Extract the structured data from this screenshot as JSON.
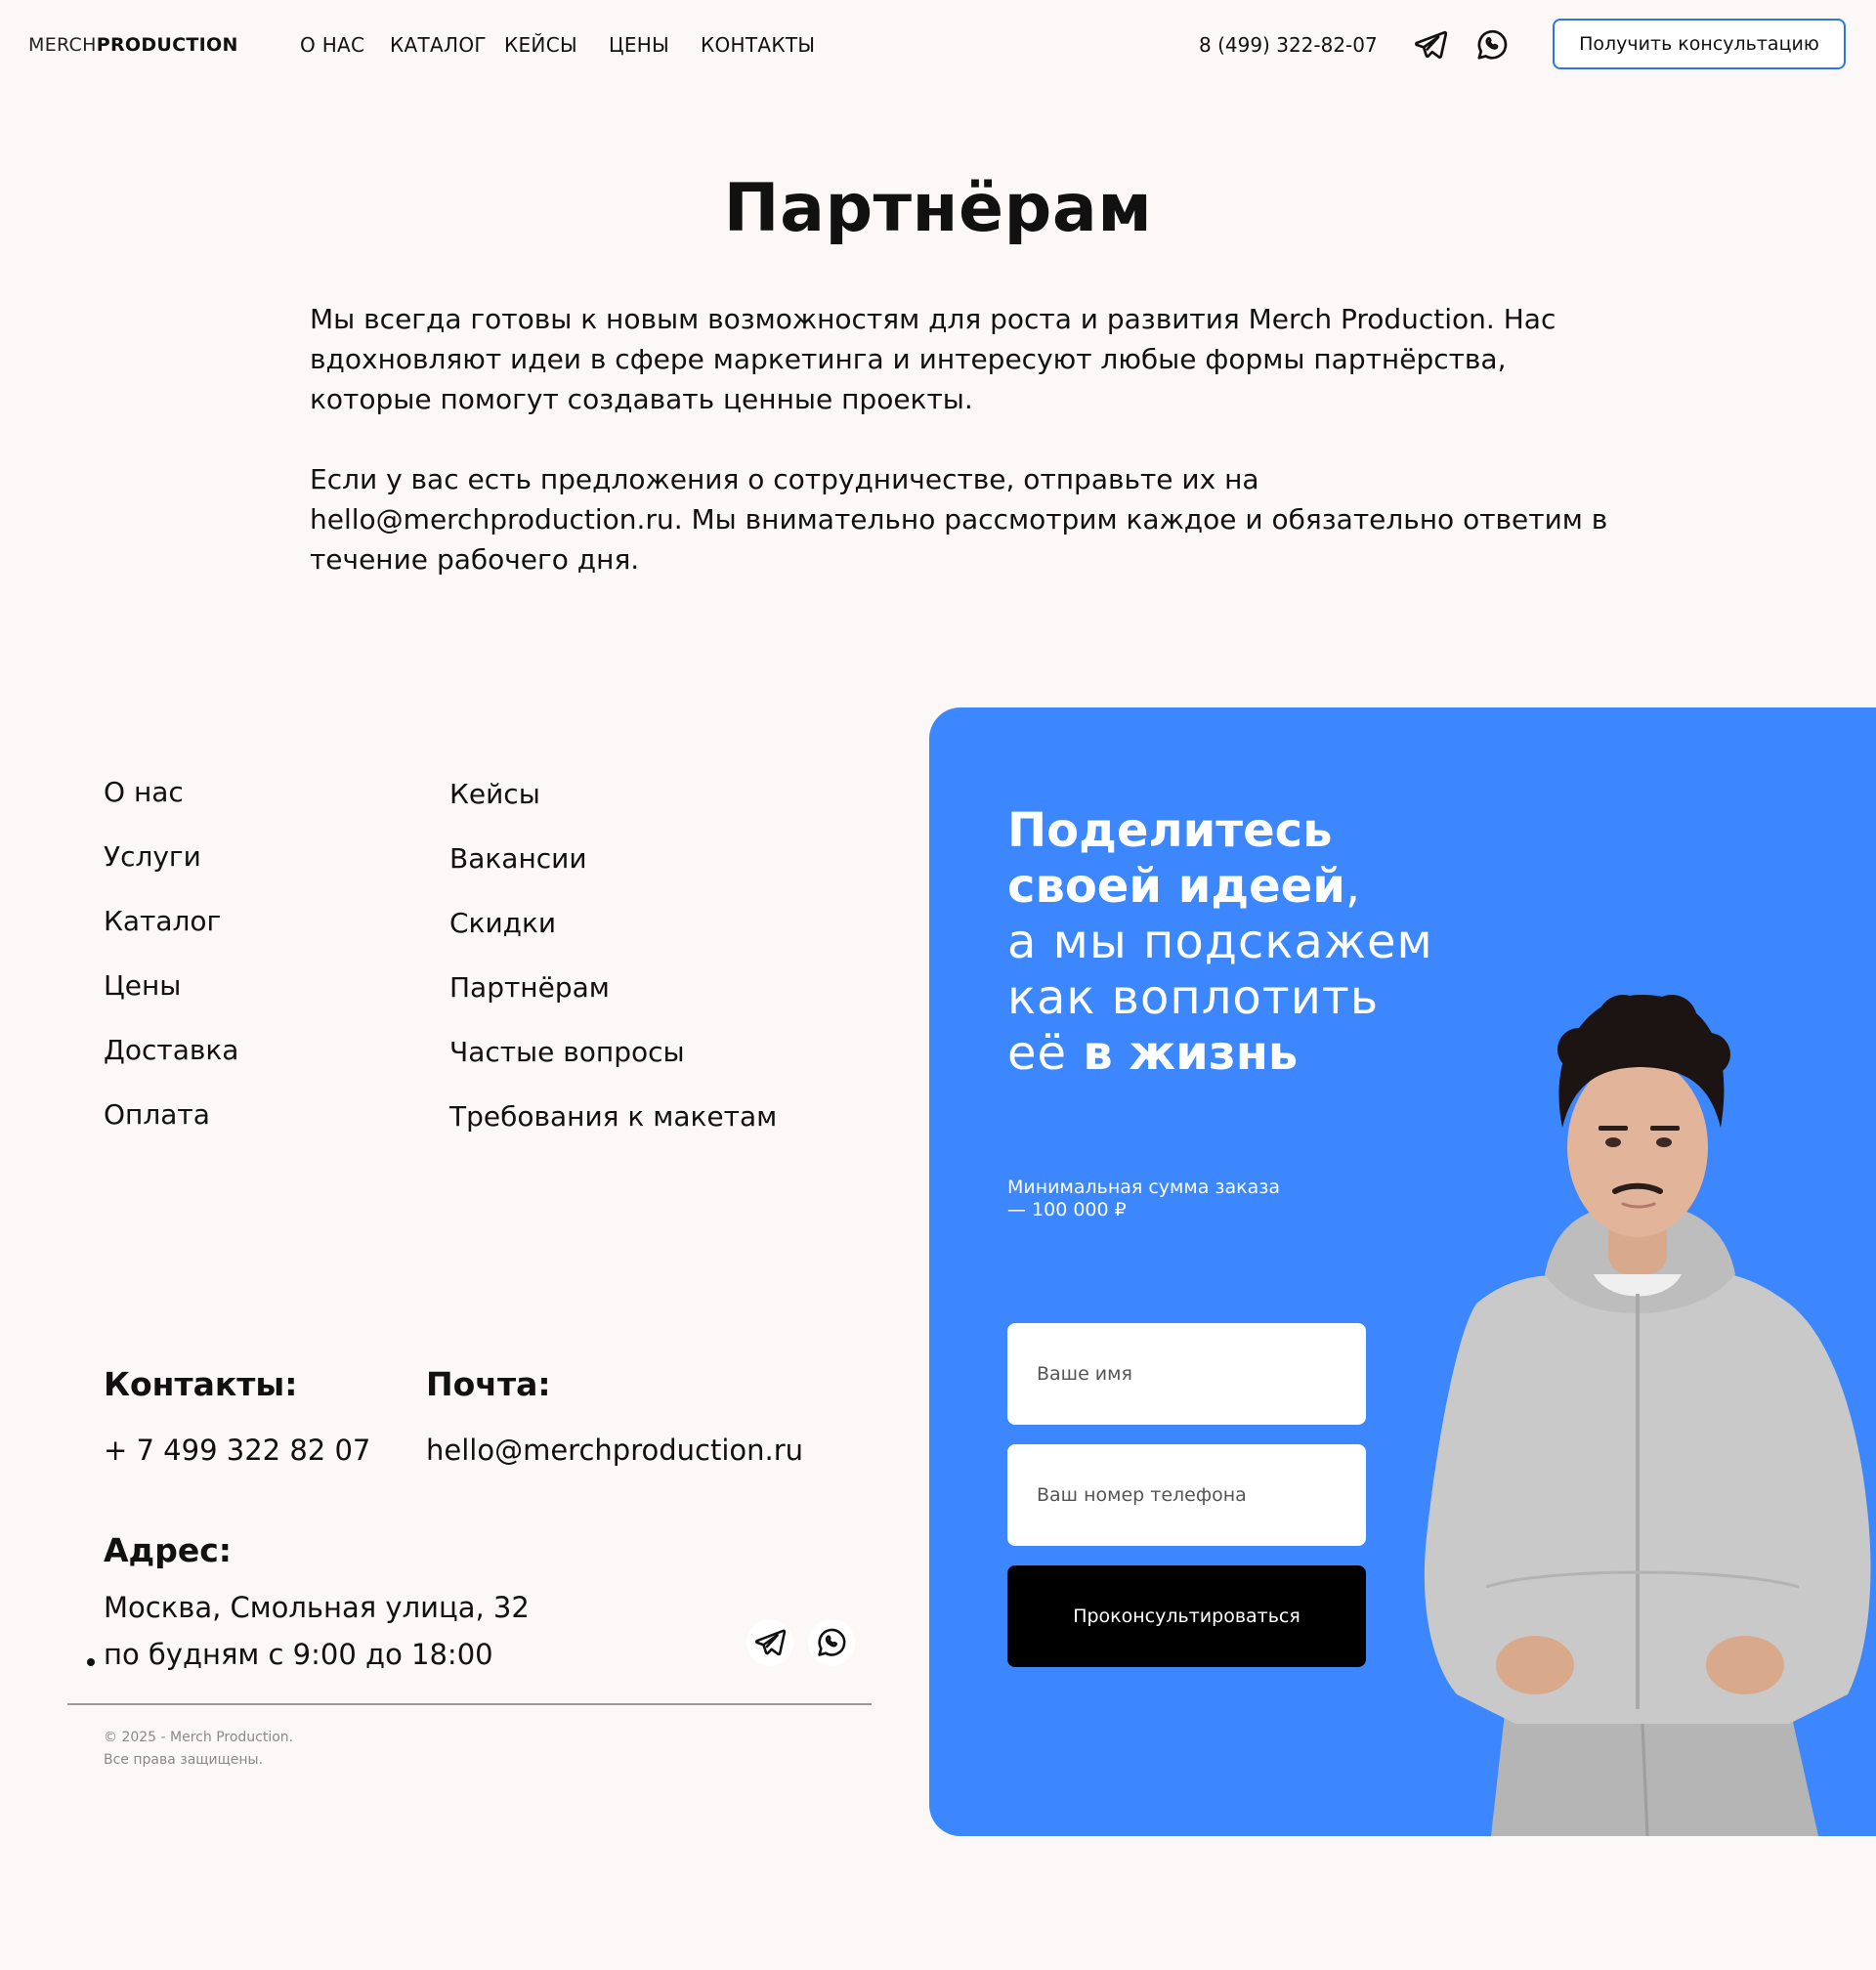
{
  "header": {
    "logo_light": "MERCH",
    "logo_bold": "PRODUCTION",
    "nav": [
      "О НАС",
      "КАТАЛОГ",
      "КЕЙСЫ",
      "ЦЕНЫ",
      "КОНТАКТЫ"
    ],
    "phone": "8 (499) 322-82-07",
    "cta_label": "Получить консультацию"
  },
  "partners": {
    "title": "Партнёрам",
    "paragraph_1": "Мы всегда готовы к новым возможностям для роста и развития Merch Production. Нас вдохновляют идеи в сфере маркетинга и интересуют любые формы партнёрства, которые помогут создавать ценные проекты.",
    "paragraph_2": "Если у вас есть предложения о сотрудничестве, отправьте их на hello@merchproduction.ru. Мы внимательно рассмотрим каждое и обязательно ответим в течение рабочего дня."
  },
  "footer": {
    "col1": [
      "О нас",
      "Услуги",
      "Каталог",
      "Цены",
      "Доставка",
      "Оплата"
    ],
    "col2": [
      "Кейсы",
      "Вакансии",
      "Скидки",
      "Партнёрам",
      "Частые вопросы",
      "Требования к макетам"
    ],
    "contacts_title": "Контакты:",
    "contacts_phone": "+ 7 499 322 82 07",
    "mail_title": "Почта:",
    "mail_value": "hello@merchproduction.ru",
    "address_title": "Адрес:",
    "address_value": "Москва, Смольная улица, 32",
    "hours": "по будням с 9:00 до 18:00",
    "copyright_1": "© 2025 - Merch Production.",
    "copyright_2": "Все права защищены."
  },
  "form_card": {
    "headline_1": "Поделитесь",
    "headline_2": "своей идеей",
    "headline_comma": ",",
    "headline_3": "а мы подскажем",
    "headline_4": "как воплотить",
    "headline_5a": "её ",
    "headline_5b": "в жизнь",
    "min_order": "Минимальная сумма заказа — 100 000 ₽",
    "name_placeholder": "Ваше имя",
    "phone_placeholder": "Ваш номер телефона",
    "submit_label": "Проконсультироваться",
    "bg_color": "#3c87fd"
  },
  "icons": {
    "telegram": "telegram-icon",
    "whatsapp": "whatsapp-icon"
  }
}
